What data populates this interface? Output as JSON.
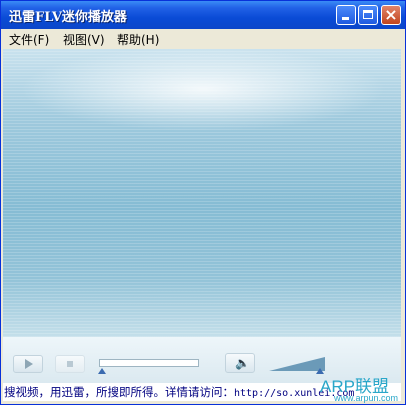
{
  "window": {
    "title": "迅雷FLV迷你播放器"
  },
  "menu": [
    {
      "label": "文件(F)"
    },
    {
      "label": "视图(V)"
    },
    {
      "label": "帮助(H)"
    }
  ],
  "controls": {
    "seek_position": 0,
    "volume_level": 1.0
  },
  "status": {
    "text": "搜视频，用迅雷，所搜即所得。详情请访问：",
    "url": "http://so.xunlei.com"
  },
  "watermark": {
    "main": "ARP联盟",
    "sub": "www.arpun.com"
  },
  "colors": {
    "titlebar": "#0a4bd6",
    "status_text": "#000080",
    "watermark": "#2aa7c9"
  }
}
